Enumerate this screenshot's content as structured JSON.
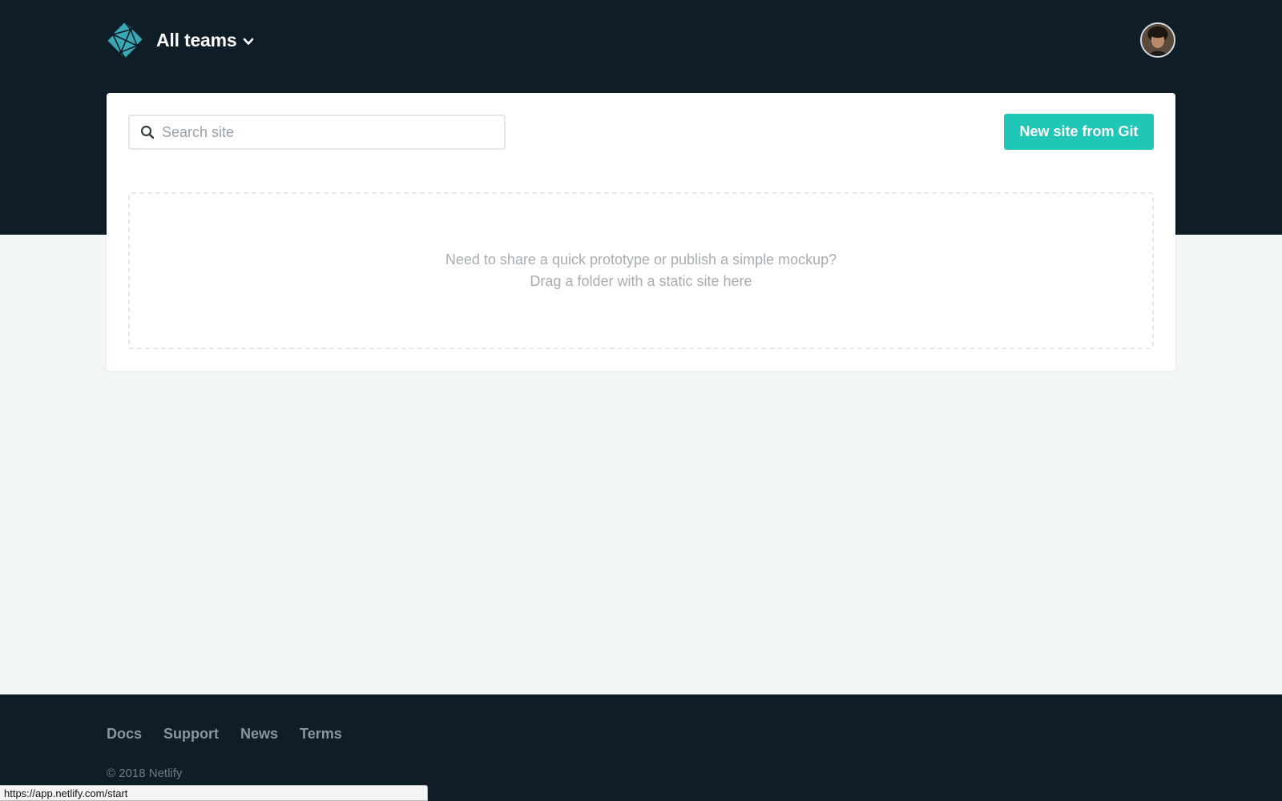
{
  "header": {
    "team_label": "All teams",
    "logo_icon": "netlify-logo-icon",
    "chevron_icon": "chevron-down-icon",
    "avatar_icon": "user-avatar-icon"
  },
  "search": {
    "placeholder": "Search site",
    "value": "",
    "icon": "search-icon"
  },
  "actions": {
    "new_site_label": "New site from Git"
  },
  "dropzone": {
    "line1": "Need to share a quick prototype or publish a simple mockup?",
    "line2": "Drag a folder with a static site here"
  },
  "footer": {
    "links": [
      "Docs",
      "Support",
      "News",
      "Terms"
    ],
    "copyright": "© 2018 Netlify"
  },
  "status_bar": {
    "url": "https://app.netlify.com/start"
  },
  "colors": {
    "header_bg": "#0f1d26",
    "page_bg": "#f3f6f7",
    "accent": "#20c6b6",
    "logo": "#3aa9b6"
  }
}
